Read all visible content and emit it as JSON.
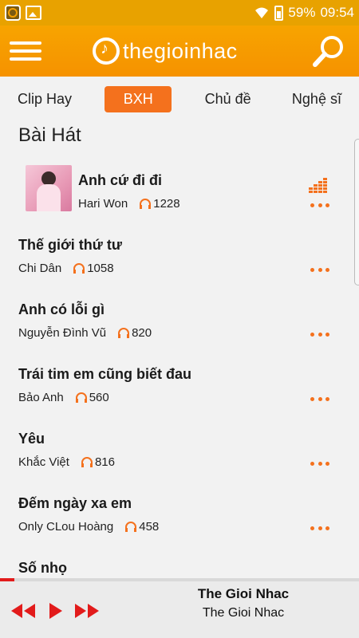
{
  "status_bar": {
    "battery": "59%",
    "time": "09:54"
  },
  "header": {
    "logo_text": "thegioinhac"
  },
  "tabs": [
    {
      "label": "Clip Hay"
    },
    {
      "label": "BXH"
    },
    {
      "label": "Chủ đề"
    },
    {
      "label": "Nghệ sĩ"
    }
  ],
  "section_title": "Bài Hát",
  "songs": [
    {
      "title": "Anh cứ đi đi",
      "artist": "Hari Won",
      "plays": "1228"
    },
    {
      "title": "Thế giới thứ tư",
      "artist": "Chi Dân",
      "plays": "1058"
    },
    {
      "title": "Anh có lỗi gì",
      "artist": "Nguyễn Đình Vũ",
      "plays": "820"
    },
    {
      "title": "Trái tim em cũng biết đau",
      "artist": "Bảo Anh",
      "plays": "560"
    },
    {
      "title": "Yêu",
      "artist": "Khắc Việt",
      "plays": "816"
    },
    {
      "title": "Đếm ngày xa em",
      "artist": "Only CLou Hoàng",
      "plays": "458"
    },
    {
      "title": "Số nhọ"
    }
  ],
  "player": {
    "title": "The Gioi Nhac",
    "artist": "The Gioi Nhac",
    "progress": 0.04
  },
  "colors": {
    "status_bar": "#e8a200",
    "header": "#f69200",
    "accent": "#f4711d",
    "progress": "#e21b1b"
  }
}
